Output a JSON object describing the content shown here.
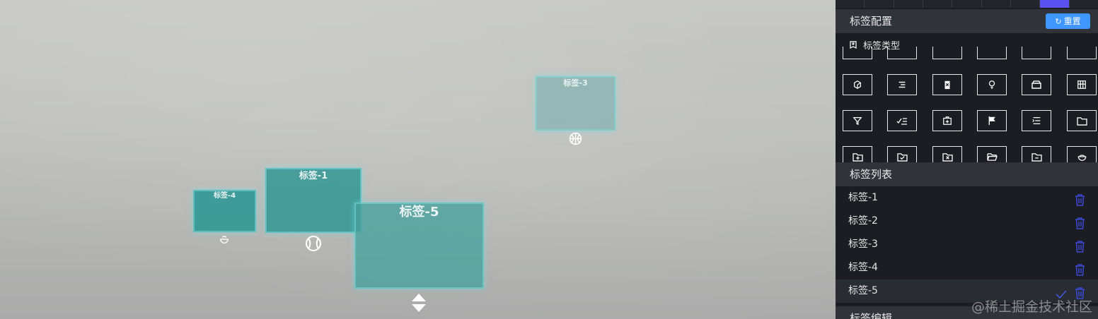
{
  "scene": {
    "tags": [
      {
        "id": "tag-4",
        "label": "标签-4",
        "icon": "rice-bowl-icon"
      },
      {
        "id": "tag-1",
        "label": "标签-1",
        "icon": "baseball-icon"
      },
      {
        "id": "tag-5",
        "label": "标签-5",
        "icon": "up-down-arrows-icon"
      },
      {
        "id": "tag-3",
        "label": "标签-3",
        "icon": "basketball-icon"
      }
    ]
  },
  "panel": {
    "tag_config": {
      "title": "标签配置",
      "reset_label": "重置"
    },
    "tag_type": {
      "label": "标签类型"
    },
    "icon_grid": [
      "rotate-cube-icon",
      "align-right-icon",
      "clipboard-x-icon",
      "lightbulb-icon",
      "archive-tray-icon",
      "table-icon",
      "filter-icon",
      "checklist-icon",
      "medical-box-icon",
      "flag-icon",
      "indent-list-icon",
      "folder-icon",
      "folder-add-icon",
      "folder-check-icon",
      "folder-x-icon",
      "folder-open-icon",
      "folder-minus-icon",
      "rice-bowl-icon"
    ],
    "tag_list": {
      "title": "标签列表",
      "items": [
        {
          "label": "标签-1",
          "selected": false
        },
        {
          "label": "标签-2",
          "selected": false
        },
        {
          "label": "标签-3",
          "selected": false
        },
        {
          "label": "标签-4",
          "selected": false
        },
        {
          "label": "标签-5",
          "selected": true
        }
      ]
    },
    "tag_edit": {
      "title": "标签编辑"
    }
  },
  "watermark": "@稀土掘金技术社区",
  "colors": {
    "accent_blue": "#4096ff",
    "active_tab": "#5a52f0",
    "trash_blue": "#3b49d6",
    "tag_teal": "#3a9a98",
    "panel_bg": "#1c1d22",
    "section_bg": "#31333b"
  }
}
